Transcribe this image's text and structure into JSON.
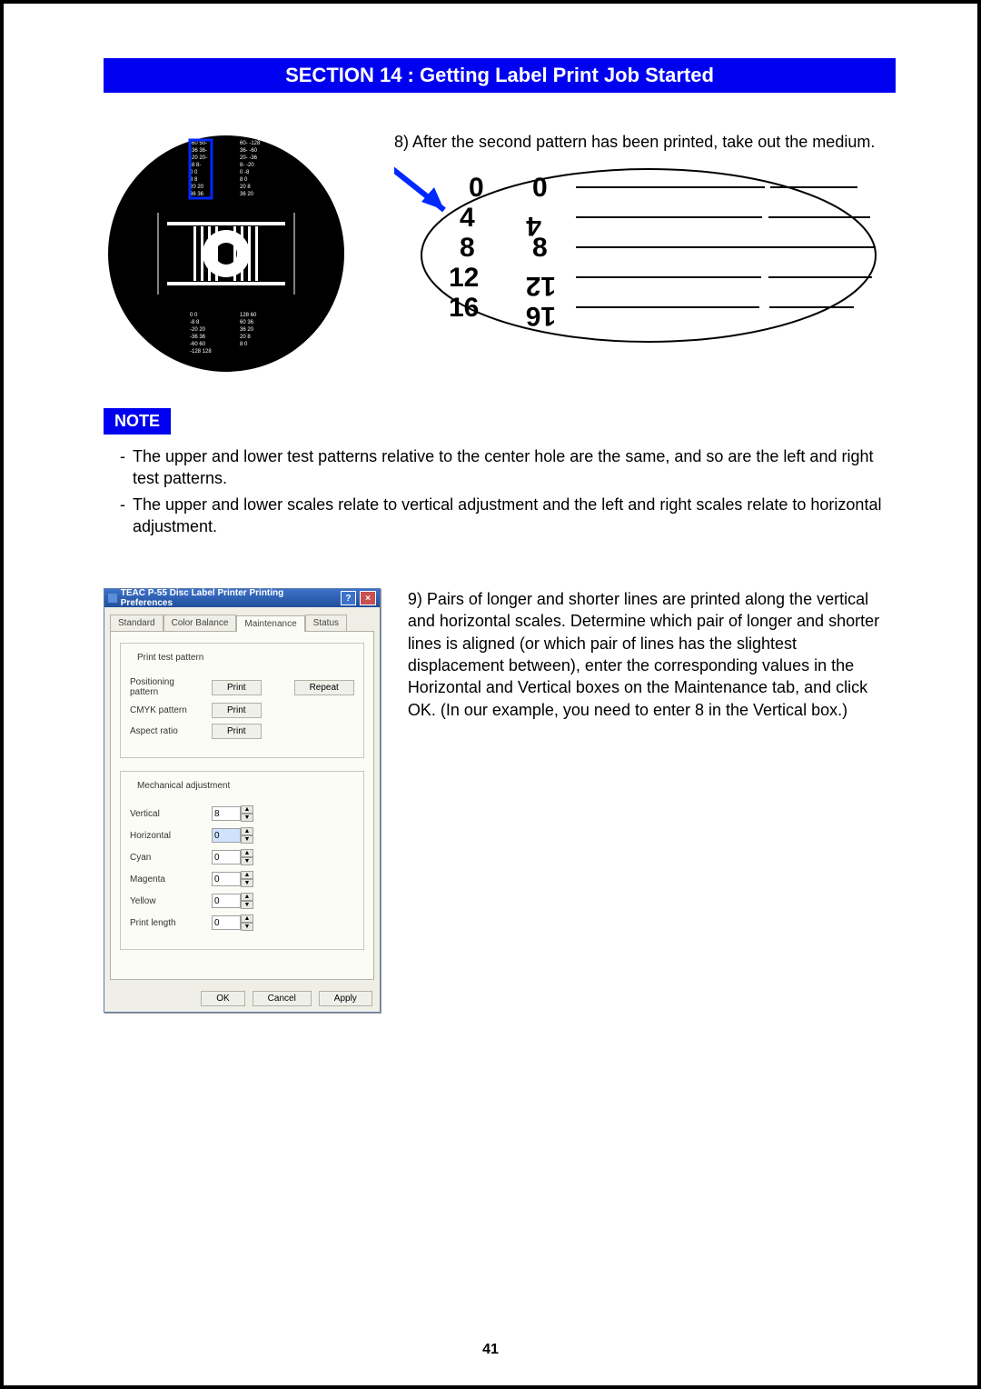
{
  "header": {
    "title": "SECTION 14 : Getting Label Print Job Started"
  },
  "content": {
    "step8": "8) After the second pattern has been printed, take out the medium.",
    "step9": "9) Pairs of longer and shorter lines are printed along the vertical and horizontal scales. Determine which pair of longer and shorter lines is aligned (or which pair of lines has the slightest displacement between), enter the corresponding values in the Horizontal and Vertical boxes on the Maintenance tab, and click OK. (In our example, you need to enter 8 in the Vertical box.)"
  },
  "ellipse": {
    "values": [
      "0",
      "4",
      "8",
      "12",
      "16"
    ]
  },
  "note": {
    "label": "NOTE",
    "items": [
      "The upper and lower test patterns relative to the center hole are the same, and so are the left and right test patterns.",
      "The upper and lower scales relate to vertical adjustment and the left and right scales relate to horizontal adjustment."
    ]
  },
  "dialog": {
    "title": "TEAC P-55 Disc Label Printer Printing Preferences",
    "tabs": [
      "Standard",
      "Color Balance",
      "Maintenance",
      "Status"
    ],
    "group1": {
      "title": "Print test pattern",
      "rows": [
        {
          "label": "Positioning pattern",
          "btn": "Print",
          "btn2": "Repeat"
        },
        {
          "label": "CMYK pattern",
          "btn": "Print"
        },
        {
          "label": "Aspect ratio",
          "btn": "Print"
        }
      ]
    },
    "group2": {
      "title": "Mechanical adjustment",
      "fields": [
        {
          "label": "Vertical",
          "value": "8"
        },
        {
          "label": "Horizontal",
          "value": "0"
        },
        {
          "label": "Cyan",
          "value": "0"
        },
        {
          "label": "Magenta",
          "value": "0"
        },
        {
          "label": "Yellow",
          "value": "0"
        },
        {
          "label": "Print length",
          "value": "0"
        }
      ]
    },
    "actions": {
      "ok": "OK",
      "cancel": "Cancel",
      "apply": "Apply"
    }
  },
  "footer": {
    "page": "41"
  }
}
